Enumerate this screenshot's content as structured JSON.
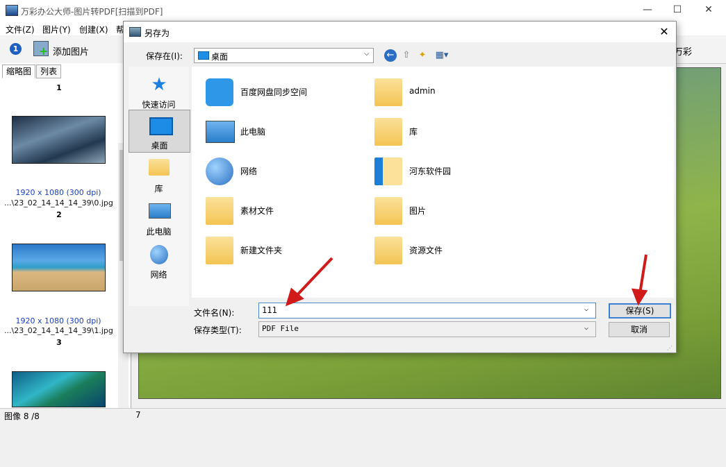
{
  "window": {
    "title": "万彩办公大师-图片转PDF[扫描到PDF]",
    "controls": [
      "—",
      "☐",
      "✕"
    ]
  },
  "menu": [
    "文件(Z)",
    "图片(Y)",
    "创建(X)",
    "帮"
  ],
  "toolbar": {
    "info_badge": "1",
    "add_label": "添加图片",
    "right_label": "万彩"
  },
  "left_panel": {
    "tabs": [
      "缩略图",
      "列表"
    ],
    "thumbs": [
      {
        "num": "1",
        "dims": "1920 x 1080 (300 dpi)",
        "file": "...\\23_02_14_14_14_39\\0.jpg"
      },
      {
        "num": "2",
        "dims": "1920 x 1080 (300 dpi)",
        "file": "...\\23_02_14_14_14_39\\1.jpg"
      },
      {
        "num": "3"
      }
    ]
  },
  "status": {
    "left": "图像 8 /8",
    "mid": "7"
  },
  "dialog": {
    "title": "另存为",
    "close": "✕",
    "save_in_label": "保存在(I):",
    "save_in_value": "桌面",
    "places": [
      "快速访问",
      "桌面",
      "库",
      "此电脑",
      "网络"
    ],
    "selected_place": "桌面",
    "files": [
      {
        "name": "百度网盘同步空间",
        "icon": "baidu-netdisk-icon"
      },
      {
        "name": "admin",
        "icon": "user-folder-icon"
      },
      {
        "name": "此电脑",
        "icon": "computer-icon"
      },
      {
        "name": "库",
        "icon": "library-icon"
      },
      {
        "name": "网络",
        "icon": "network-icon"
      },
      {
        "name": "河东软件园",
        "icon": "folder-icon"
      },
      {
        "name": "素材文件",
        "icon": "folder-icon"
      },
      {
        "name": "图片",
        "icon": "folder-icon"
      },
      {
        "name": "新建文件夹",
        "icon": "folder-icon"
      },
      {
        "name": "资源文件",
        "icon": "folder-icon"
      }
    ],
    "filename_label": "文件名(N):",
    "filename_value": "111",
    "filetype_label": "保存类型(T):",
    "filetype_value": "PDF File",
    "save_button": "保存(S)",
    "cancel_button": "取消"
  },
  "colors": {
    "accent": "#3c7fd1",
    "arrow": "#d11a1a",
    "dims_text": "#1a3fbf"
  }
}
